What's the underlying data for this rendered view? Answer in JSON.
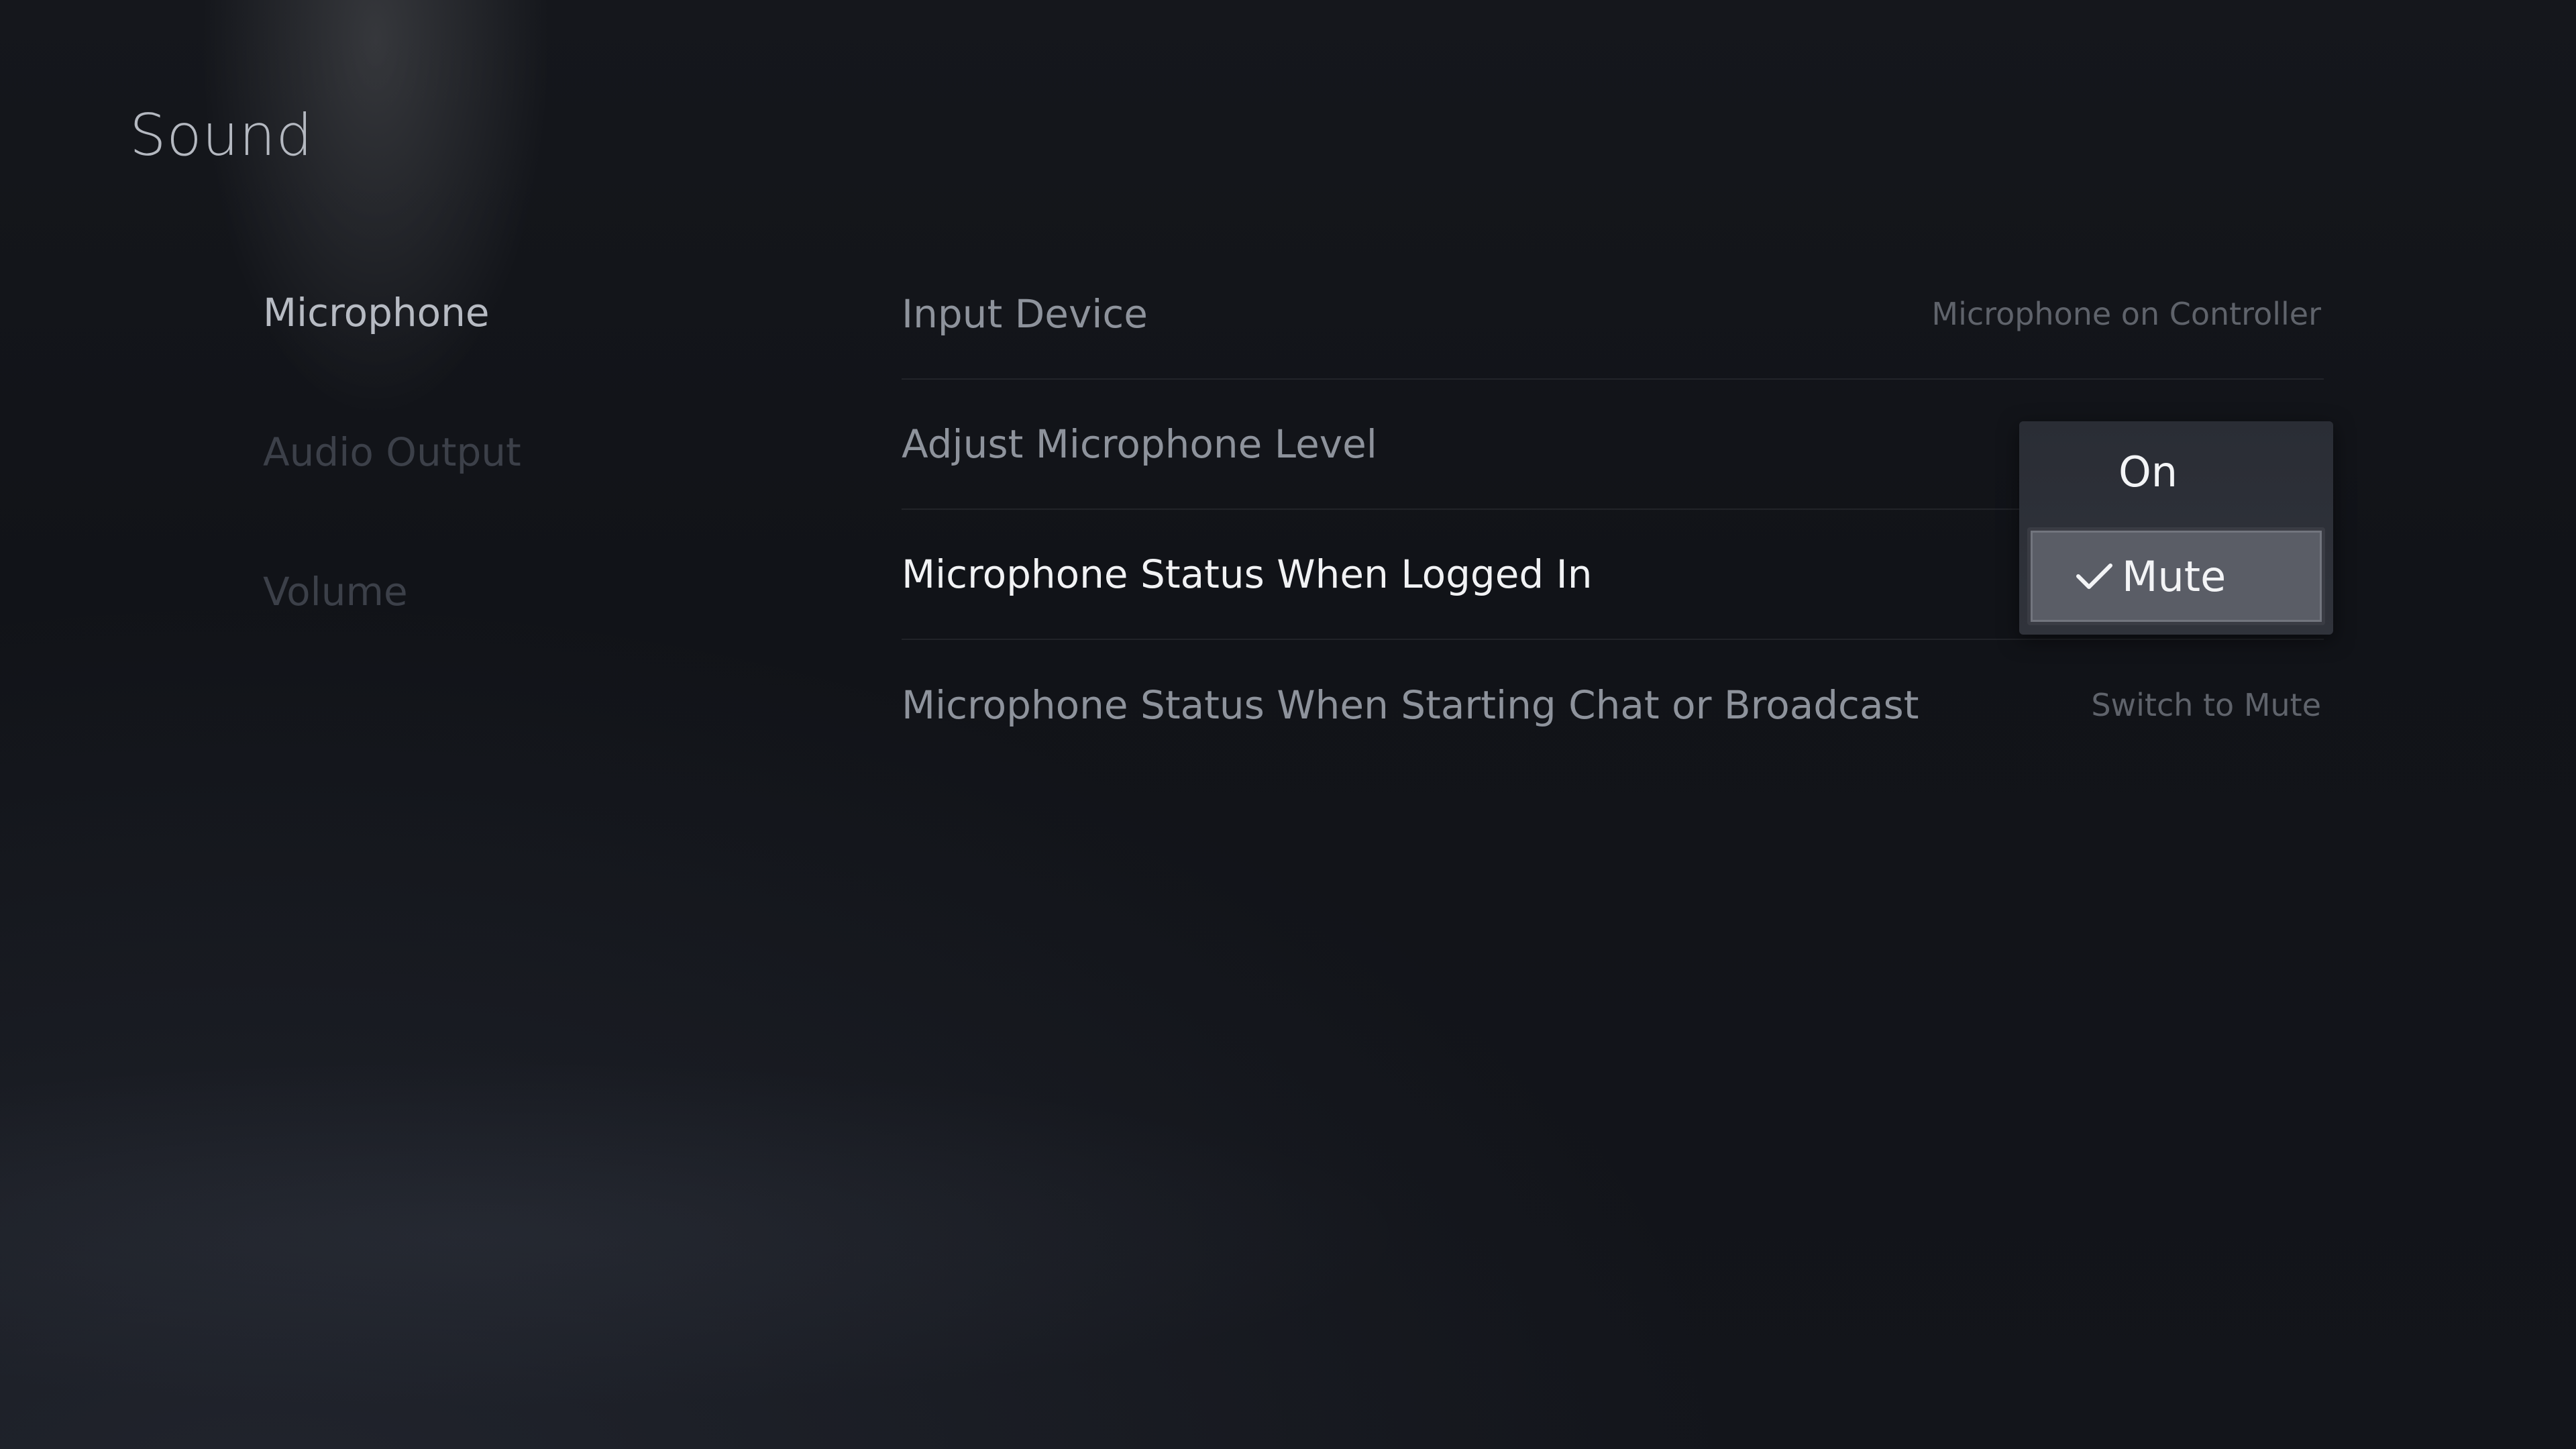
{
  "page": {
    "title": "Sound"
  },
  "sidebar": {
    "items": [
      {
        "label": "Microphone",
        "active": true
      },
      {
        "label": "Audio Output",
        "active": false
      },
      {
        "label": "Volume",
        "active": false
      }
    ]
  },
  "settings": {
    "rows": [
      {
        "label": "Input Device",
        "value": "Microphone on Controller"
      },
      {
        "label": "Adjust Microphone Level",
        "value": ""
      },
      {
        "label": "Microphone Status When Logged In",
        "value": ""
      },
      {
        "label": "Microphone Status When Starting Chat or Broadcast",
        "value": "Switch to Mute"
      }
    ]
  },
  "dropdown": {
    "options": [
      {
        "label": "On",
        "selected": false
      },
      {
        "label": "Mute",
        "selected": true
      }
    ],
    "check_icon": "checkmark-icon"
  },
  "colors": {
    "background": "#111319",
    "focused_text": "#f1f2f4",
    "selected_option_bg": "#5a5d66"
  }
}
